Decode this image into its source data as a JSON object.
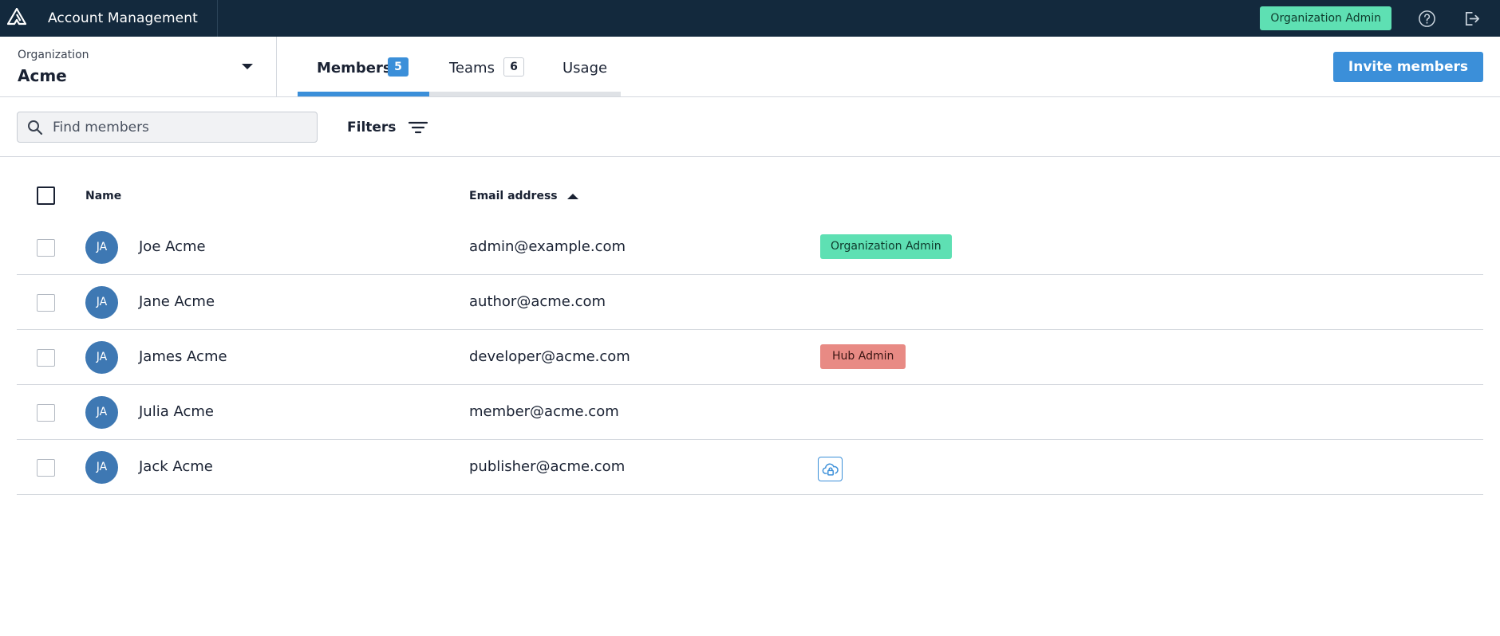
{
  "header": {
    "title": "Account Management",
    "role_badge": "Organization Admin",
    "icons": [
      "logo-icon",
      "help-icon",
      "logout-icon"
    ]
  },
  "organization": {
    "label": "Organization",
    "name": "Acme"
  },
  "tabs": [
    {
      "label": "Members",
      "count": "5",
      "active": true
    },
    {
      "label": "Teams",
      "count": "6",
      "active": false
    },
    {
      "label": "Usage",
      "active": false
    }
  ],
  "invite_button": "Invite members",
  "search": {
    "placeholder": "Find members",
    "value": ""
  },
  "filters_label": "Filters",
  "table": {
    "columns": [
      "Name",
      "Email address"
    ],
    "sort": {
      "column": "Email address",
      "direction": "ascending"
    },
    "rows": [
      {
        "initials": "JA",
        "name": "Joe Acme",
        "email": "admin@example.com",
        "role": "Organization Admin",
        "checked": false
      },
      {
        "initials": "JA",
        "name": "Jane Acme",
        "email": "author@acme.com",
        "role": "",
        "checked": false
      },
      {
        "initials": "JA",
        "name": "James Acme",
        "email": "developer@acme.com",
        "role": "Hub Admin",
        "checked": false
      },
      {
        "initials": "JA",
        "name": "Julia Acme",
        "email": "member@acme.com",
        "role": "",
        "checked": false
      },
      {
        "initials": "JA",
        "name": "Jack Acme",
        "email": "publisher@acme.com",
        "role_icon": "publisher-icon",
        "checked": false
      }
    ]
  },
  "colors": {
    "topbar": "#13293d",
    "accent": "#3b8fd9",
    "org_admin_tag": "#5ee0b3",
    "hub_admin_tag": "#e88a84",
    "avatar": "#3e78b3"
  }
}
